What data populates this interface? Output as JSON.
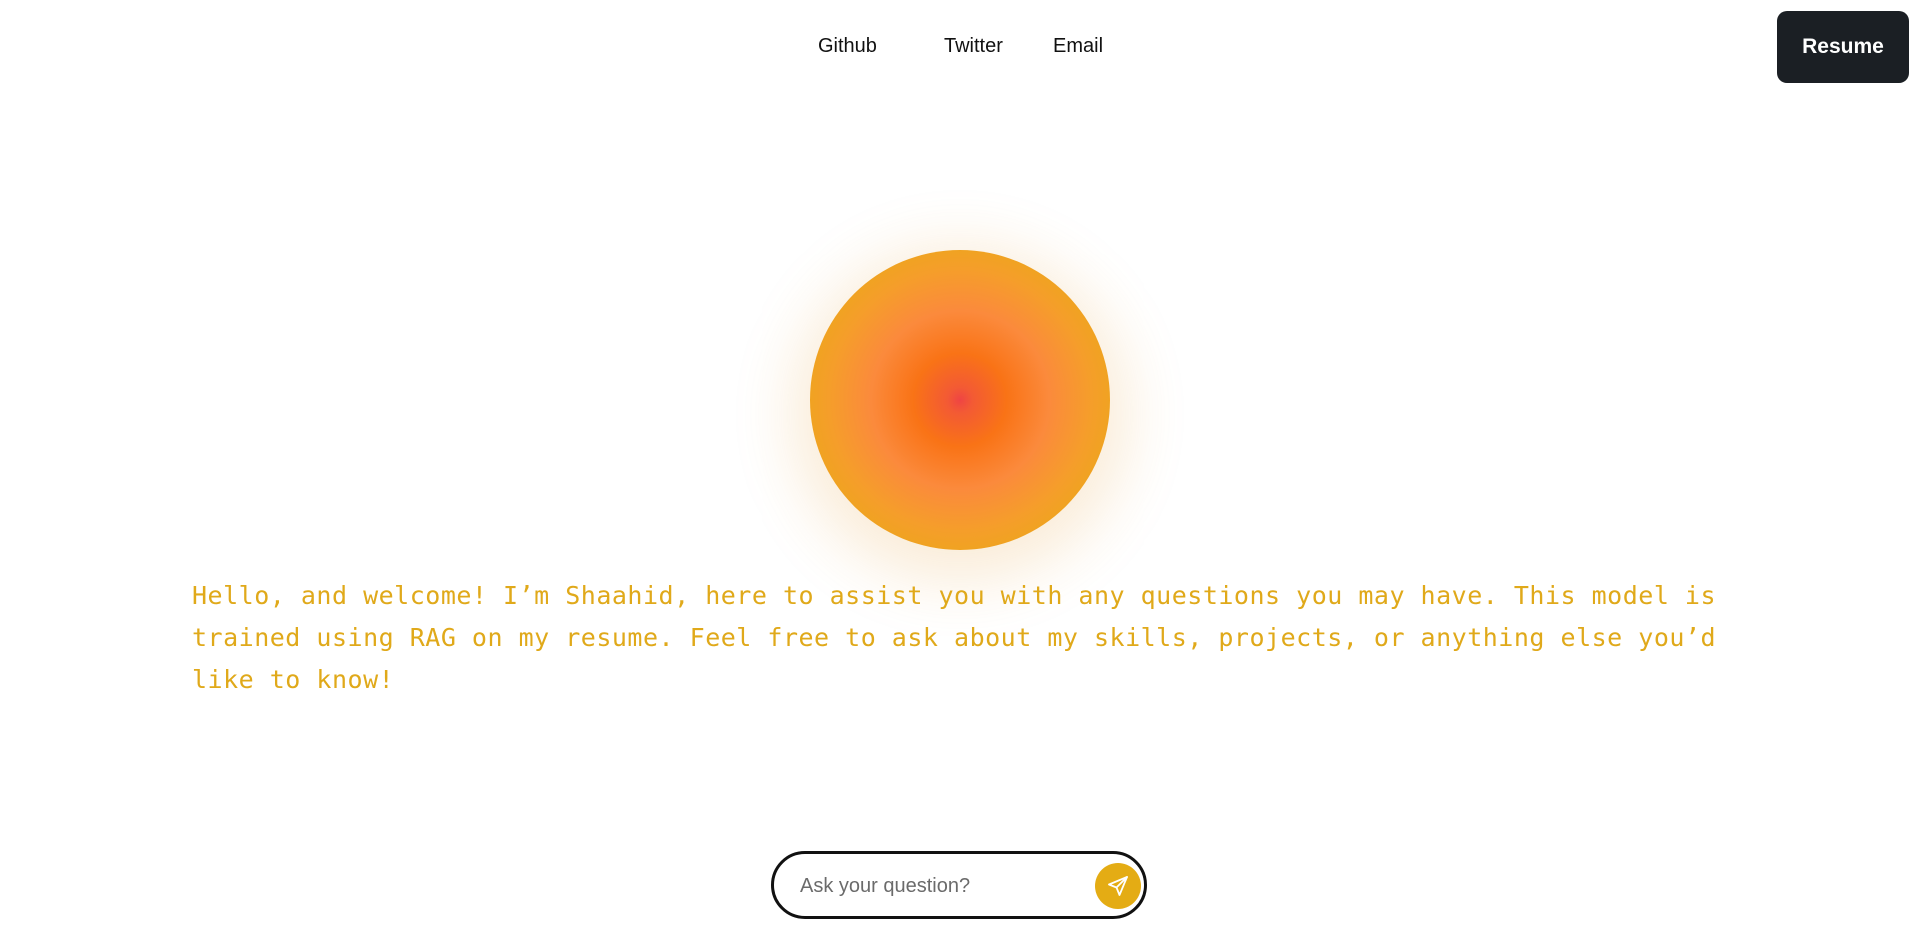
{
  "nav": {
    "links": [
      {
        "label": "Github"
      },
      {
        "label": "Twitter"
      },
      {
        "label": "Email"
      }
    ],
    "resume_label": "Resume"
  },
  "orb": {
    "center_color": "#ef4444",
    "mid_color": "#f97316",
    "edge_color": "#e9ab16"
  },
  "welcome": {
    "text": "Hello, and welcome! I’m Shaahid, here to assist you with any questions you may have. This model is trained using RAG on my resume. Feel free to ask about my skills, projects, or anything else you’d like to know!"
  },
  "chat": {
    "placeholder": "Ask your question?",
    "send_icon": "send-icon"
  },
  "colors": {
    "accent": "#e4ac14",
    "text_accent": "#e0a91a",
    "button_dark": "#1b1f24"
  }
}
